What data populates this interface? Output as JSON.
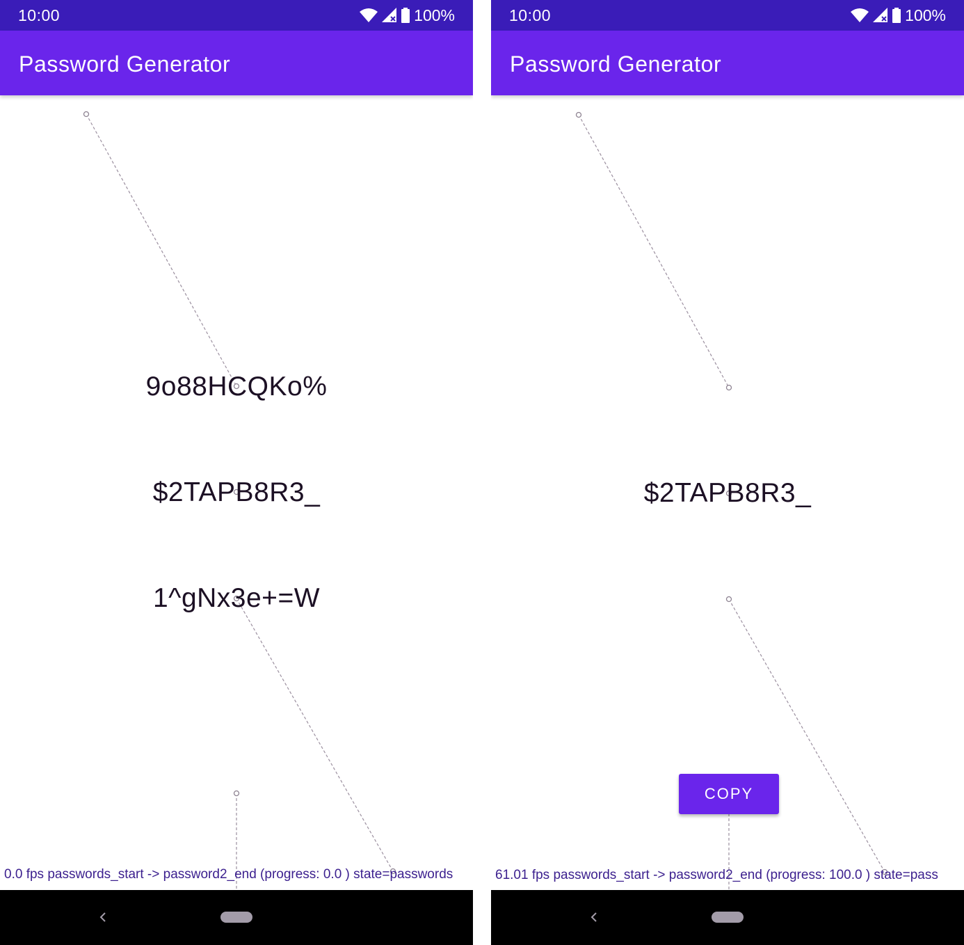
{
  "left_screen": {
    "status_bar": {
      "time": "10:00",
      "battery": "100%",
      "icons": [
        "wifi-icon",
        "cell-signal-icon",
        "battery-icon"
      ]
    },
    "app_bar": {
      "title": "Password Generator"
    },
    "passwords": [
      "9o88HCQKo%",
      "$2TAPB8R3_",
      "1^gNx3e+=W"
    ],
    "debug_text": "0.0 fps passwords_start -> password2_end (progress: 0.0 ) state=passwords",
    "nav_bar": {
      "icons": [
        "back-icon",
        "home-pill-icon"
      ]
    }
  },
  "right_screen": {
    "status_bar": {
      "time": "10:00",
      "battery": "100%",
      "icons": [
        "wifi-icon",
        "cell-signal-icon",
        "battery-icon"
      ]
    },
    "app_bar": {
      "title": "Password Generator"
    },
    "passwords": [
      "$2TAPB8R3_"
    ],
    "copy_button": {
      "label": "COPY"
    },
    "debug_text": "61.01 fps passwords_start -> password2_end (progress: 100.0 ) state=pass",
    "nav_bar": {
      "icons": [
        "back-icon",
        "home-pill-icon"
      ]
    }
  },
  "colors": {
    "status_bar": "#3a1cb8",
    "app_bar": "#6a25eb",
    "button": "#6a25eb",
    "debug_text": "#3b1f8e",
    "nav_bar": "#000000"
  }
}
